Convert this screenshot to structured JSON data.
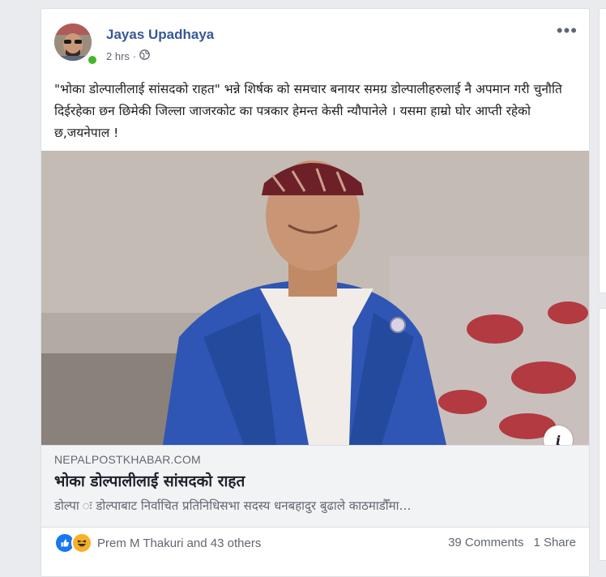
{
  "post": {
    "author": "Jayas Upadhaya",
    "time": "2 hrs",
    "audience_icon": "globe-icon",
    "more_icon": "more-options-icon",
    "more_label": "•••",
    "text": "\"भोका डोल्पालीलाई सांसदको राहत\" भन्ने शिर्षक को समचार बनायर समग्र डोल्पालीहरुलाई नै अपमान गरी चुनौति दिईरहेका छन छिमेकी जिल्ला जाजरकोट का पत्रकार हेमन्त केसी न्यौपानेले । यसमा हाम्रो घोर आप्ती रहेको छ,जयनेपाल !"
  },
  "link": {
    "domain": "NEPALPOSTKHABAR.COM",
    "title": "भोका डोल्पालीलाई सांसदको राहत",
    "description": "डोल्पा ः डोल्पाबाट निर्वाचित प्रतिनिधिसभा सदस्य धनबहादुर बुढाले काठमाडौँमा…",
    "info_label": "i"
  },
  "reactions": {
    "summary": "Prem M Thakuri and 43 others",
    "types": [
      "like-icon",
      "haha-icon"
    ],
    "colors": {
      "like": "#1877f2",
      "haha": "#f7b125"
    }
  },
  "counts": {
    "comments": "39 Comments",
    "shares": "1 Share"
  },
  "colors": {
    "author": "#385898",
    "online": "#42b72a",
    "background": "#e9ebee"
  }
}
